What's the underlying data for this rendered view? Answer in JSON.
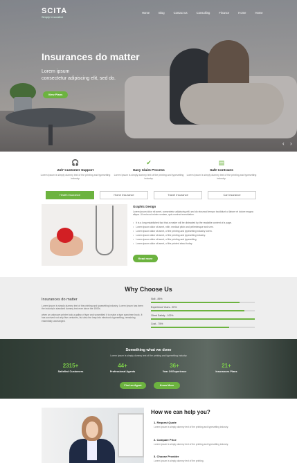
{
  "brand": {
    "logo": "SCITA",
    "tagline": "Simply Innovative"
  },
  "nav": [
    "Home",
    "Blog",
    "Contact us",
    "Consulting",
    "Finance",
    "Home",
    "Home"
  ],
  "hero": {
    "title": "Insurances do matter",
    "line1": "Lorem ipsum",
    "line2": "consectetur adipiscing elit, sed do.",
    "button": "View Plans",
    "prev": "‹",
    "next": "›"
  },
  "features": [
    {
      "icon": "headset-icon",
      "glyph": "🎧",
      "title": "24/7 Customer Support",
      "desc": "Lorem Ipsum is simply dummy text of the printing and typesetting industry."
    },
    {
      "icon": "check-icon",
      "glyph": "✔",
      "title": "Easy Claim Process",
      "desc": "Lorem Ipsum is simply dummy text of the printing and typesetting industry."
    },
    {
      "icon": "document-icon",
      "glyph": "▤",
      "title": "Safe Contracts",
      "desc": "Lorem Ipsum is simply dummy text of the printing and typesetting industry."
    }
  ],
  "tabs": [
    "Health Insurance",
    "Home Insurance",
    "Travel Insurance",
    "Car Insurance"
  ],
  "graphic": {
    "title": "Graphic Design",
    "text": "Lorem ipsum dolor sit amet, consectetur adipiscing elit, sed do eiusmod tempor incididunt ut labore et dolore magna aliqua. Ut enim ad minim veniam, quis nostrud exercitation.",
    "list": [
      "It is a long established fact that a reader will be distracted by the readable content of a page.",
      "Lorem ipsum dolor sit amet, nibh, medical pitch and pellentesque sed sem.",
      "Lorem ipsum dolor sit amet, of the printing and typesetting industry lorem.",
      "Lorem ipsum dolor sit amet, of the printing and typesetting industry.",
      "Lorem ipsum dolor sit amet, of the printing and typesetting.",
      "Lorem ipsum dolor sit amet, of the printed about today."
    ],
    "button": "Read more"
  },
  "why": {
    "title": "Why Choose Us",
    "subtitle": "Insurances do matter",
    "text1": "Lorem Ipsum is simply dummy text of the printing and typesetting industry. Lorem Ipsum has been the industry's standard dummy text ever since the 1500s.",
    "text2": "when an unknown printer took a galley of type and scrambled it to make a type specimen book. It has survived not only five centuries, but also the leap into electronic typesetting, remaining essentially unchanged.",
    "bars": [
      {
        "label": "Skill - 85%",
        "value": 0.85
      },
      {
        "label": "Experience Years - 90%",
        "value": 0.9
      },
      {
        "label": "Client Satisfy - 100%",
        "value": 1.0
      },
      {
        "label": "Cost - 75%",
        "value": 0.75
      }
    ]
  },
  "stats": {
    "title": "Something what we done",
    "sub": "Lorem Ipsum is simply dummy text of the printing and typesetting industry",
    "items": [
      {
        "num": "2315+",
        "label": "Satisfied Customers"
      },
      {
        "num": "44+",
        "label": "Professional Agents"
      },
      {
        "num": "36+",
        "label": "Year Of Experience"
      },
      {
        "num": "21+",
        "label": "Insurances Plans"
      }
    ],
    "btn1": "Find an Agent",
    "btn2": "Know More"
  },
  "help": {
    "title": "How we can help you?",
    "steps": [
      {
        "title": "1. Request Quote",
        "desc": "Lorem Ipsum is simply dummy text of the printing and typesetting industry."
      },
      {
        "title": "2. Compare Price",
        "desc": "Lorem Ipsum is simply dummy text of the printing and typesetting industry."
      },
      {
        "title": "3. Choose Provider",
        "desc": "Lorem Ipsum is simply dummy text of the printing."
      }
    ]
  },
  "colors": {
    "accent": "#6cb33f"
  }
}
